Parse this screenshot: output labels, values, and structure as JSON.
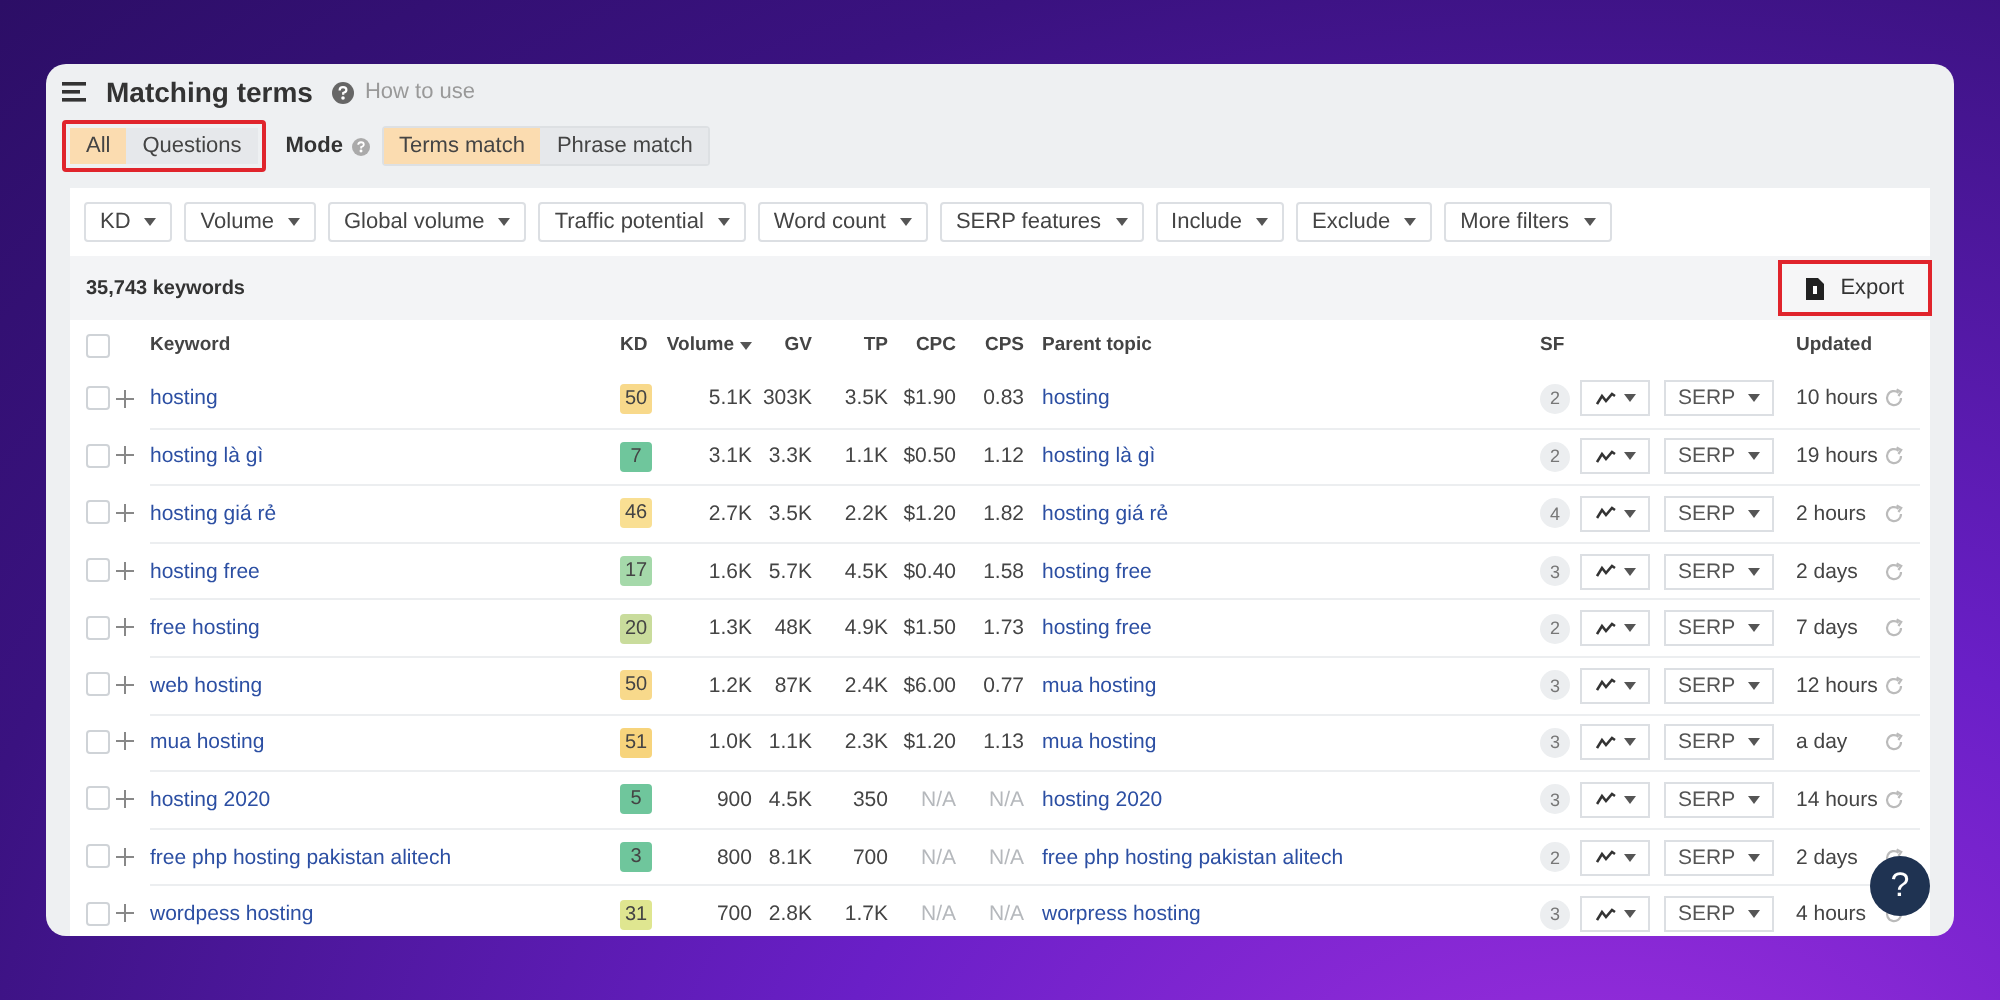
{
  "title": "Matching terms",
  "help_link": "How to use",
  "scope_tabs": {
    "highlighted": true,
    "items": [
      {
        "label": "All",
        "selected": true
      },
      {
        "label": "Questions",
        "selected": false
      }
    ]
  },
  "mode": {
    "label": "Mode",
    "items": [
      {
        "label": "Terms match",
        "selected": true
      },
      {
        "label": "Phrase match",
        "selected": false
      }
    ]
  },
  "filters": [
    "KD",
    "Volume",
    "Global volume",
    "Traffic potential",
    "Word count",
    "SERP features",
    "Include",
    "Exclude",
    "More filters"
  ],
  "keyword_count": "35,743 keywords",
  "export": {
    "label": "Export",
    "highlighted": true
  },
  "table": {
    "select_all_checked": false,
    "columns": [
      {
        "label": "Keyword",
        "sorted": false
      },
      {
        "label": "KD",
        "sorted": false
      },
      {
        "label": "Volume",
        "sorted": true
      },
      {
        "label": "GV",
        "sorted": false
      },
      {
        "label": "TP",
        "sorted": false
      },
      {
        "label": "CPC",
        "sorted": false
      },
      {
        "label": "CPS",
        "sorted": false
      },
      {
        "label": "Parent topic",
        "sorted": false
      },
      {
        "label": "SF",
        "sorted": false
      },
      {
        "label": "Updated",
        "sorted": false
      }
    ],
    "rows": [
      {
        "checked": false,
        "keyword": "hosting",
        "kd": {
          "value": "50",
          "color": "#f8d98b"
        },
        "volume": "5.1K",
        "gv": "303K",
        "tp": "3.5K",
        "cpc": "$1.90",
        "cps": "0.83",
        "na": false,
        "parent_topic": "hosting",
        "sf": "2",
        "serp": "SERP",
        "updated": "10 hours"
      },
      {
        "checked": false,
        "keyword": "hosting là gì",
        "kd": {
          "value": "7",
          "color": "#6fc69c"
        },
        "volume": "3.1K",
        "gv": "3.3K",
        "tp": "1.1K",
        "cpc": "$0.50",
        "cps": "1.12",
        "na": false,
        "parent_topic": "hosting là gì",
        "sf": "2",
        "serp": "SERP",
        "updated": "19 hours"
      },
      {
        "checked": false,
        "keyword": "hosting giá rẻ",
        "kd": {
          "value": "46",
          "color": "#f9df93"
        },
        "volume": "2.7K",
        "gv": "3.5K",
        "tp": "2.2K",
        "cpc": "$1.20",
        "cps": "1.82",
        "na": false,
        "parent_topic": "hosting giá rẻ",
        "sf": "4",
        "serp": "SERP",
        "updated": "2 hours"
      },
      {
        "checked": false,
        "keyword": "hosting free",
        "kd": {
          "value": "17",
          "color": "#a5d9aa"
        },
        "volume": "1.6K",
        "gv": "5.7K",
        "tp": "4.5K",
        "cpc": "$0.40",
        "cps": "1.58",
        "na": false,
        "parent_topic": "hosting free",
        "sf": "3",
        "serp": "SERP",
        "updated": "2 days"
      },
      {
        "checked": false,
        "keyword": "free hosting",
        "kd": {
          "value": "20",
          "color": "#c9dc9c"
        },
        "volume": "1.3K",
        "gv": "48K",
        "tp": "4.9K",
        "cpc": "$1.50",
        "cps": "1.73",
        "na": false,
        "parent_topic": "hosting free",
        "sf": "2",
        "serp": "SERP",
        "updated": "7 days"
      },
      {
        "checked": false,
        "keyword": "web hosting",
        "kd": {
          "value": "50",
          "color": "#f8d98b"
        },
        "volume": "1.2K",
        "gv": "87K",
        "tp": "2.4K",
        "cpc": "$6.00",
        "cps": "0.77",
        "na": false,
        "parent_topic": "mua hosting",
        "sf": "3",
        "serp": "SERP",
        "updated": "12 hours"
      },
      {
        "checked": false,
        "keyword": "mua hosting",
        "kd": {
          "value": "51",
          "color": "#f7d47c"
        },
        "volume": "1.0K",
        "gv": "1.1K",
        "tp": "2.3K",
        "cpc": "$1.20",
        "cps": "1.13",
        "na": false,
        "parent_topic": "mua hosting",
        "sf": "3",
        "serp": "SERP",
        "updated": "a day"
      },
      {
        "checked": false,
        "keyword": "hosting 2020",
        "kd": {
          "value": "5",
          "color": "#6fc69c"
        },
        "volume": "900",
        "gv": "4.5K",
        "tp": "350",
        "cpc": "N/A",
        "cps": "N/A",
        "na": true,
        "parent_topic": "hosting 2020",
        "sf": "3",
        "serp": "SERP",
        "updated": "14 hours"
      },
      {
        "checked": false,
        "keyword": "free php hosting pakistan alitech",
        "kd": {
          "value": "3",
          "color": "#6fc69c"
        },
        "volume": "800",
        "gv": "8.1K",
        "tp": "700",
        "cpc": "N/A",
        "cps": "N/A",
        "na": true,
        "parent_topic": "free php hosting pakistan alitech",
        "sf": "2",
        "serp": "SERP",
        "updated": "2 days"
      },
      {
        "checked": false,
        "keyword": "wordpess hosting",
        "kd": {
          "value": "31",
          "color": "#dfe690"
        },
        "volume": "700",
        "gv": "2.8K",
        "tp": "1.7K",
        "cpc": "N/A",
        "cps": "N/A",
        "na": true,
        "parent_topic": "worpress hosting",
        "sf": "3",
        "serp": "SERP",
        "updated": "4 hours"
      }
    ]
  },
  "help_button": "?"
}
